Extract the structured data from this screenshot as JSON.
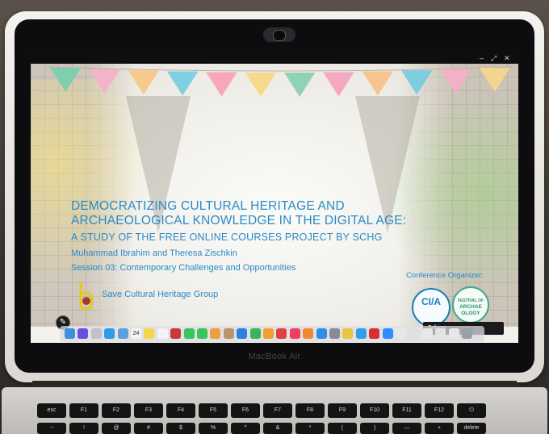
{
  "window": {
    "controls": [
      "–",
      "⤢",
      "✕"
    ]
  },
  "slide": {
    "title_line1": "DEMOCRATIZING CULTURAL HERITAGE AND",
    "title_line2": "ARCHAEOLOGICAL KNOWLEDGE IN THE DIGITAL AGE:",
    "title_line3": "A STUDY OF THE FREE ONLINE COURSES PROJECT BY SCHG",
    "authors": "Muhammad Ibrahim and Theresa Zischkin",
    "session": "Session 03: Contemporary Challenges and Opportunities",
    "organizer_label": "Conference Organizer:",
    "org_name": "Save Cultural Heritage Group",
    "cia_logo_text": "CI/A",
    "arch_logo_lines": [
      "FESTIVAL OF",
      "ARCHAE",
      "OLOGY"
    ]
  },
  "overlay": {
    "talking_label": "Talking:",
    "pen_icon": "✎"
  },
  "colors": {
    "title_blue": "#2a8ac8",
    "bunting": [
      "#7fcfae",
      "#f3b3c8",
      "#f7c98a",
      "#7fd0e0",
      "#f7a7b8",
      "#f6d98c",
      "#8fd3b6",
      "#f5a8c0",
      "#f6c58f",
      "#7ccde0",
      "#f2b1c6",
      "#f4d491"
    ]
  },
  "dock": {
    "icons": [
      "finder-icon",
      "siri-icon",
      "launchpad-icon",
      "safari-icon",
      "folder-icon",
      "calendar-icon",
      "notes-icon",
      "reminders-icon",
      "photo-booth-icon",
      "messages-icon",
      "facetime-icon",
      "photos-icon",
      "contacts-icon",
      "keynote-icon",
      "numbers-icon",
      "pages-icon",
      "no-entry-icon",
      "music-icon",
      "books-icon",
      "app-store-icon",
      "system-prefs-icon",
      "chrome-icon",
      "skype-icon",
      "zotero-icon",
      "zoom-icon",
      "doc-1-icon",
      "doc-2-icon",
      "doc-3-icon",
      "doc-4-icon",
      "doc-5-icon",
      "trash-icon"
    ],
    "icon_colors": [
      "#3d8fe0",
      "#6b4de0",
      "#c0c0c8",
      "#2f9be8",
      "#5aa0e0",
      "#f4f4f4",
      "#f3d64a",
      "#f4f4f4",
      "#c83a3a",
      "#3ac45a",
      "#3ac45a",
      "#e8a040",
      "#b8956a",
      "#2f7fe0",
      "#3ab35a",
      "#f0a030",
      "#e04040",
      "#f04060",
      "#f08a30",
      "#2f8fe8",
      "#8a8a90",
      "#e8c440",
      "#2fa0e8",
      "#d83030",
      "#2d8cff",
      "#e8e8e8",
      "#e0e0e0",
      "#e8e8e8",
      "#e4e4e4",
      "#e8e8e8",
      "#9aa0a8"
    ],
    "calendar_day": "24"
  },
  "hardware": {
    "brand": "MacBook Air",
    "fn_row": [
      "esc",
      "F1",
      "F2",
      "F3",
      "F4",
      "F5",
      "F6",
      "F7",
      "F8",
      "F9",
      "F10",
      "F11",
      "F12",
      "⏻"
    ],
    "num_row": [
      "~",
      "!",
      "@",
      "#",
      "$",
      "%",
      "^",
      "&",
      "*",
      "(",
      ")",
      "—",
      "+",
      "delete"
    ]
  }
}
